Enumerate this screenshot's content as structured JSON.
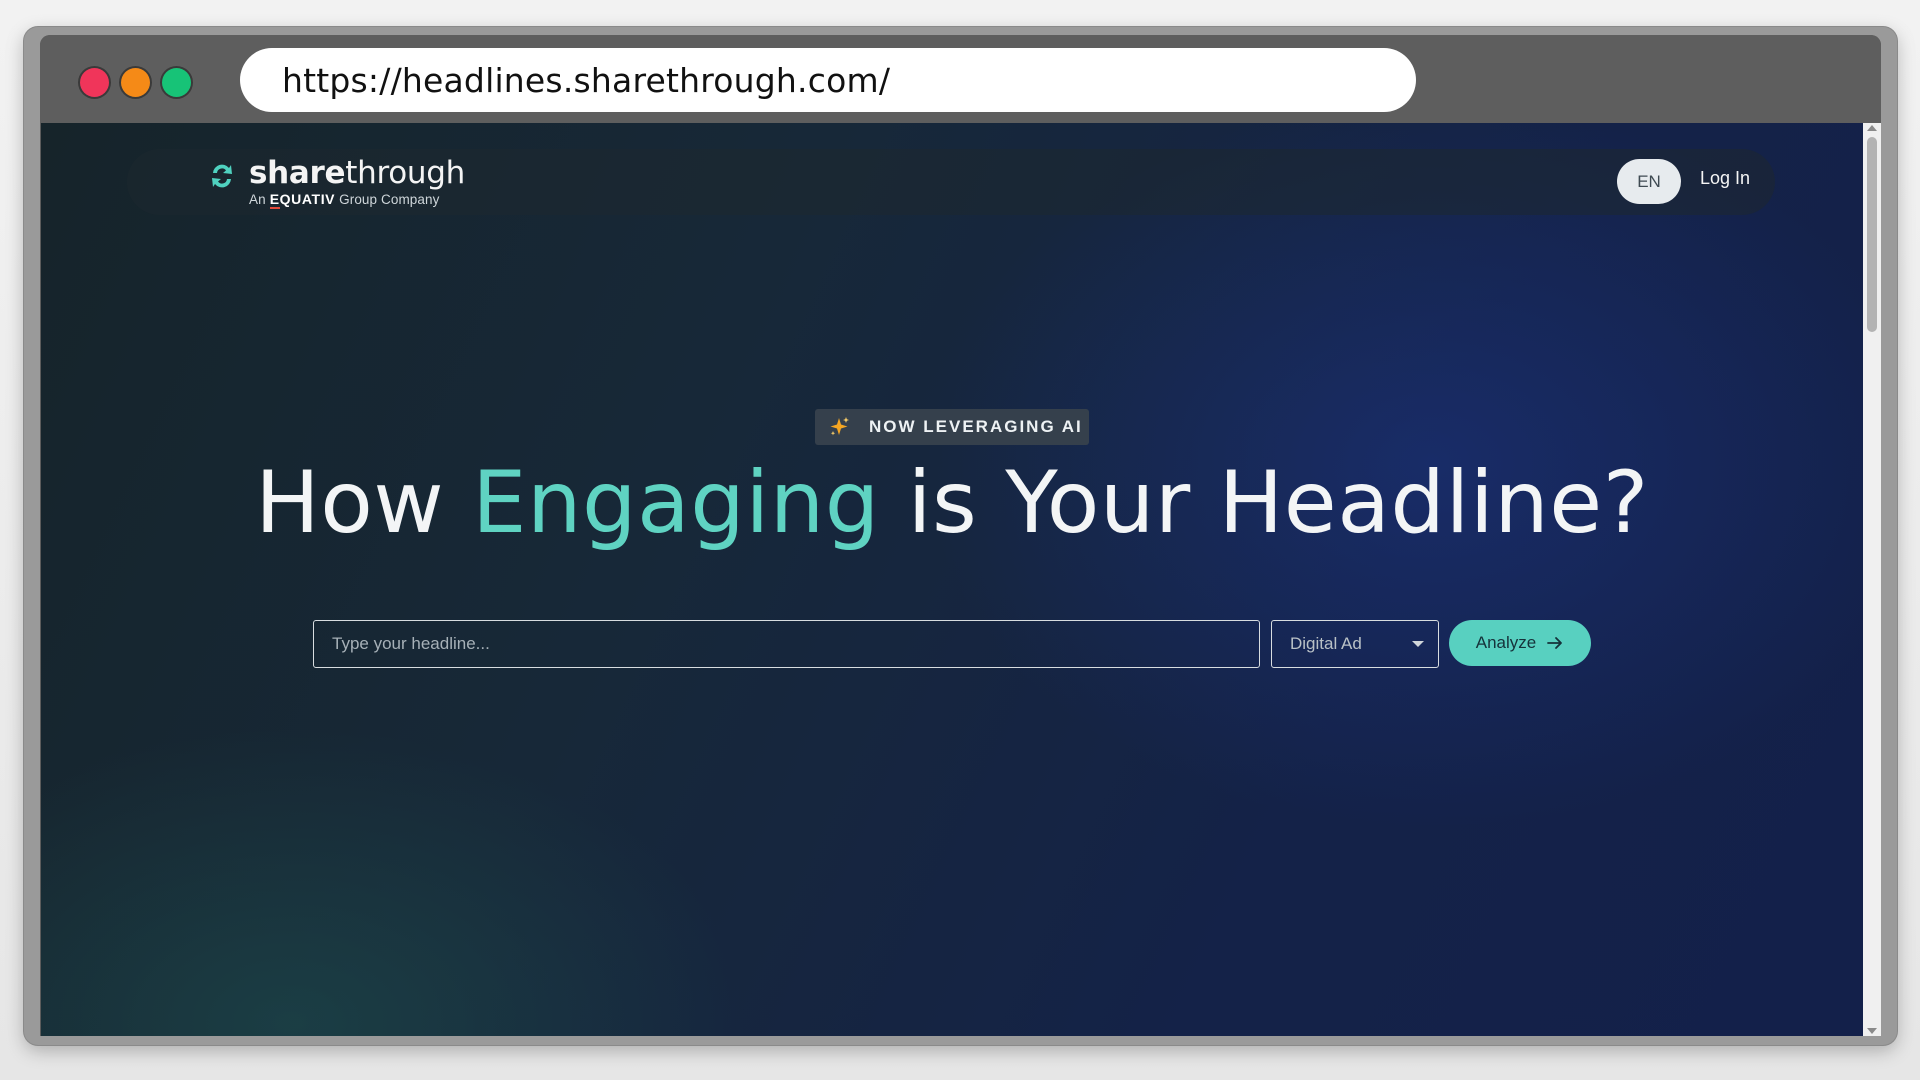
{
  "browser": {
    "url": "https://headlines.sharethrough.com/"
  },
  "nav": {
    "brand_name_bold": "share",
    "brand_name_regular": "through",
    "brand_sub_prefix": "An",
    "brand_sub_company_first": "E",
    "brand_sub_company_rest": "QUATIV",
    "brand_sub_suffix": "Group Company",
    "language": "EN",
    "login": "Log In"
  },
  "hero": {
    "badge_icon": "sparkle-icon",
    "badge": "NOW LEVERAGING AI",
    "title_prefix": "How ",
    "title_accent": "Engaging",
    "title_suffix": " is Your Headline?"
  },
  "form": {
    "headline_placeholder": "Type your headline...",
    "headline_value": "",
    "type_selected": "Digital Ad",
    "analyze_label": "Analyze",
    "analyze_icon": "arrow-right-icon"
  },
  "colors": {
    "accent": "#5fd3c2",
    "button": "#58d0c0",
    "traffic_red": "#f0355a",
    "traffic_orange": "#f58a17",
    "traffic_green": "#17c377"
  }
}
